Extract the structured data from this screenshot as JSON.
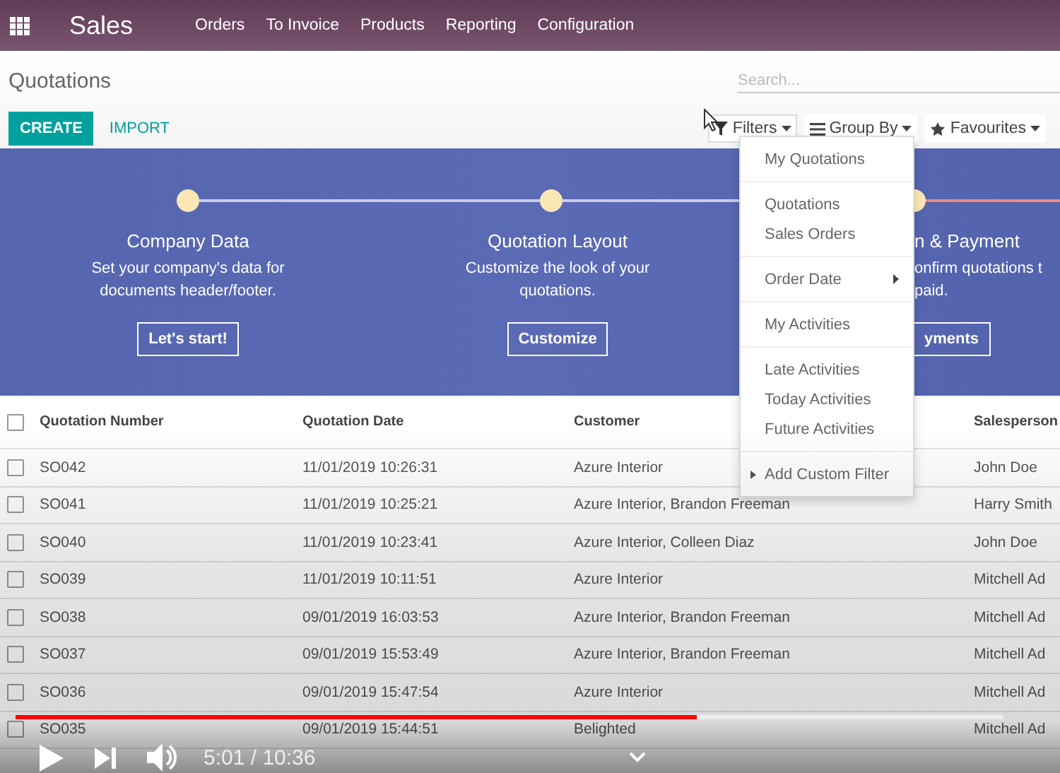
{
  "app": {
    "title": "Sales",
    "menu": [
      "Orders",
      "To Invoice",
      "Products",
      "Reporting",
      "Configuration"
    ]
  },
  "breadcrumb": "Quotations",
  "search": {
    "placeholder": "Search..."
  },
  "buttons": [
    {
      "label": "CREATE",
      "kind": "primary"
    },
    {
      "label": "IMPORT",
      "kind": "link"
    }
  ],
  "search_options": [
    {
      "label": "Filters",
      "selected": true,
      "kind": "filter"
    },
    {
      "label": "Group By",
      "selected": false,
      "kind": "group"
    },
    {
      "label": "Favourites",
      "selected": false,
      "kind": "star"
    }
  ],
  "filter_groups": [
    {
      "items": [
        {
          "label": "My Quotations",
          "kind": "option"
        }
      ]
    },
    {
      "items": [
        {
          "label": "Quotations",
          "kind": "option"
        },
        {
          "label": "Sales Orders",
          "kind": "option"
        }
      ]
    },
    {
      "items": [
        {
          "label": "Order Date",
          "kind": "submenu"
        }
      ]
    },
    {
      "items": [
        {
          "label": "My Activities",
          "kind": "option"
        }
      ]
    },
    {
      "items": [
        {
          "label": "Late Activities",
          "kind": "option"
        },
        {
          "label": "Today Activities",
          "kind": "option"
        },
        {
          "label": "Future Activities",
          "kind": "option"
        }
      ]
    },
    {
      "items": [
        {
          "label": "Add Custom Filter",
          "kind": "toggle"
        }
      ]
    }
  ],
  "onboarding": [
    {
      "kind": "full",
      "title": "Company Data",
      "description": "Set your company's data for documents header/footer.",
      "button": "Let's start!"
    },
    {
      "kind": "full",
      "title": "Quotation Layout",
      "description": "Customize the look of your quotations.",
      "button": "Customize"
    },
    {
      "kind": "partial",
      "title": "n & Payment",
      "description": "onfirm quotations t paid.",
      "button": "yments"
    }
  ],
  "table": {
    "all_checked": false,
    "columns": [
      "Quotation Number",
      "Quotation Date",
      "Customer",
      "Salesperson"
    ],
    "rows": [
      {
        "checked": false,
        "cells": [
          "SO042",
          "11/01/2019 10:26:31",
          "Azure Interior",
          "John Doe"
        ]
      },
      {
        "checked": false,
        "cells": [
          "SO041",
          "11/01/2019 10:25:21",
          "Azure Interior, Brandon Freeman",
          "Harry Smith"
        ]
      },
      {
        "checked": false,
        "cells": [
          "SO040",
          "11/01/2019 10:23:41",
          "Azure Interior, Colleen Diaz",
          "John Doe"
        ]
      },
      {
        "checked": false,
        "cells": [
          "SO039",
          "11/01/2019 10:11:51",
          "Azure Interior",
          "Mitchell Ad"
        ]
      },
      {
        "checked": false,
        "cells": [
          "SO038",
          "09/01/2019 16:03:53",
          "Azure Interior, Brandon Freeman",
          "Mitchell Ad"
        ]
      },
      {
        "checked": false,
        "cells": [
          "SO037",
          "09/01/2019 15:53:49",
          "Azure Interior, Brandon Freeman",
          "Mitchell Ad"
        ]
      },
      {
        "checked": false,
        "cells": [
          "SO036",
          "09/01/2019 15:47:54",
          "Azure Interior",
          "Mitchell Ad"
        ]
      },
      {
        "checked": false,
        "cells": [
          "SO035",
          "09/01/2019 15:44:51",
          "Belighted",
          "Mitchell Ad"
        ]
      }
    ]
  },
  "video": {
    "level": 0.69,
    "time": "5:01 / 10:36"
  }
}
